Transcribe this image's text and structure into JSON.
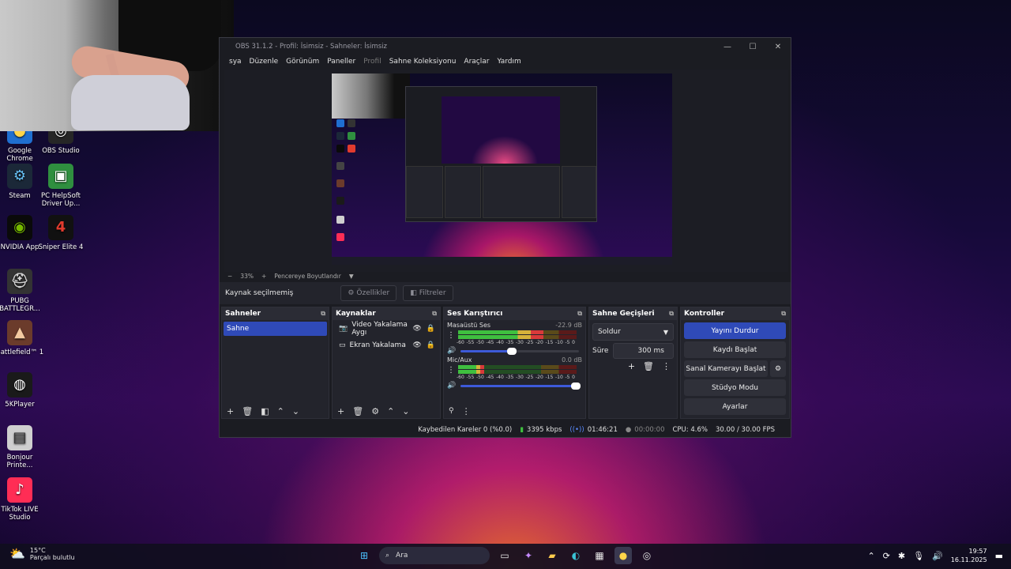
{
  "desktop": {
    "icons": [
      {
        "label": "Google Chrome",
        "glyph": "●",
        "bg": "#1f6fd1",
        "color": "#ffd54a"
      },
      {
        "label": "OBS Studio",
        "glyph": "◎",
        "bg": "#262626",
        "color": "#ffffff"
      },
      {
        "label": "Steam",
        "glyph": "⚙",
        "bg": "#1b2838",
        "color": "#66c0f4"
      },
      {
        "label": "PC HelpSoft Driver Up...",
        "glyph": "▣",
        "bg": "#2f8f3f",
        "color": "#ffffff"
      },
      {
        "label": "NVIDIA App",
        "glyph": "◉",
        "bg": "#0a0a0a",
        "color": "#76b900"
      },
      {
        "label": "Sniper Elite 4",
        "glyph": "4",
        "bg": "#111111",
        "color": "#e23b2e"
      },
      {
        "label": "PUBG BATTLEGR...",
        "glyph": "⛑",
        "bg": "#333",
        "color": "#cfcfcf"
      },
      {
        "label": "Battlefield™ 1",
        "glyph": "▲",
        "bg": "#6b3b2b",
        "color": "#f3c9a0"
      },
      {
        "label": "5KPlayer",
        "glyph": "◍",
        "bg": "#1a1a1a",
        "color": "#ffffff"
      },
      {
        "label": "Bonjour Printe...",
        "glyph": "▤",
        "bg": "#cfcfcf",
        "color": "#333333"
      },
      {
        "label": "TikTok LIVE Studio",
        "glyph": "♪",
        "bg": "#ff2d55",
        "color": "#ffffff"
      }
    ]
  },
  "obs": {
    "title": "OBS 31.1.2 - Profil: İsimsiz - Sahneler: İsimsiz",
    "window_controls": [
      "—",
      "☐",
      "✕"
    ],
    "menu": [
      {
        "label": "sya",
        "enabled": true
      },
      {
        "label": "Düzenle",
        "enabled": true
      },
      {
        "label": "Görünüm",
        "enabled": true
      },
      {
        "label": "Paneller",
        "enabled": true
      },
      {
        "label": "Profil",
        "enabled": false
      },
      {
        "label": "Sahne Koleksiyonu",
        "enabled": true
      },
      {
        "label": "Araçlar",
        "enabled": true
      },
      {
        "label": "Yardım",
        "enabled": true
      }
    ],
    "zoom": {
      "minus": "−",
      "value": "33%",
      "plus": "+",
      "fit_label": "Pencereye Boyutlandır"
    },
    "source_bar": {
      "status": "Kaynak seçilmemiş",
      "properties": "Özellikler",
      "filters": "Filtreler"
    },
    "scenes": {
      "title": "Sahneler",
      "items": [
        "Sahne"
      ]
    },
    "sources": {
      "title": "Kaynaklar",
      "items": [
        {
          "name": "Video Yakalama Aygı",
          "icon": "camera-icon"
        },
        {
          "name": "Ekran Yakalama",
          "icon": "monitor-icon"
        }
      ]
    },
    "mixer": {
      "title": "Ses Karıştırıcı",
      "scale": [
        "-60",
        "-55",
        "-50",
        "-45",
        "-40",
        "-35",
        "-30",
        "-25",
        "-20",
        "-15",
        "-10",
        "-5",
        "0"
      ],
      "tracks": [
        {
          "name": "Masaüstü Ses",
          "db": "-22.9 dB",
          "level": 0.72,
          "volume": 0.46
        },
        {
          "name": "Mic/Aux",
          "db": "0.0 dB",
          "level": 0.22,
          "volume": 1.0
        }
      ]
    },
    "transitions": {
      "title": "Sahne Geçişleri",
      "selected": "Soldur",
      "duration_label": "Süre",
      "duration_value": "300 ms"
    },
    "controls": {
      "title": "Kontroller",
      "stop_stream": "Yayını Durdur",
      "start_recording": "Kaydı Başlat",
      "start_virtual_cam": "Sanal Kamerayı Başlat",
      "studio_mode": "Stüdyo Modu",
      "settings": "Ayarlar"
    },
    "status": {
      "dropped_frames": "Kaybedilen Kareler 0 (%0.0)",
      "bitrate": "3395 kbps",
      "stream_time": "01:46:21",
      "record_time": "00:00:00",
      "cpu": "CPU: 4.6%",
      "fps": "30.00 / 30.00 FPS"
    }
  },
  "taskbar": {
    "temperature": "15°C",
    "weather": "Parçalı bulutlu",
    "search_placeholder": "Ara",
    "time": "19:57",
    "date": "16.11.2025"
  },
  "colors": {
    "accent": "#2f4ab8",
    "panel": "#23242c",
    "window": "#1b1c22"
  }
}
